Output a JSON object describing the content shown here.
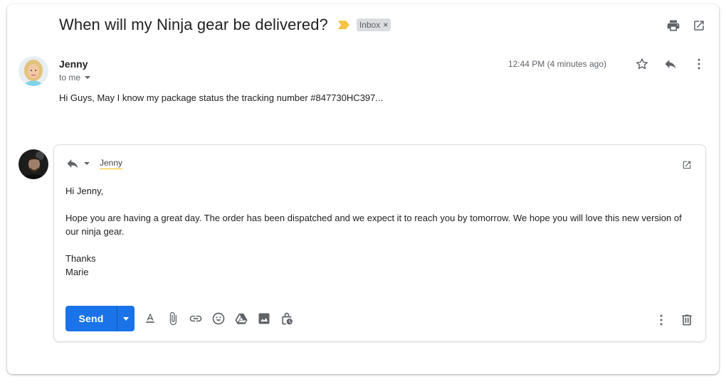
{
  "email": {
    "subject": "When will my Ninja gear be delivered?",
    "label": "Inbox",
    "label_remove": "×"
  },
  "message": {
    "sender": "Jenny",
    "to": "to me",
    "timestamp": "12:44 PM (4 minutes ago)",
    "snippet": "Hi Guys, May I know my package status the tracking number #847730HC397..."
  },
  "reply": {
    "recipient": "Jenny",
    "greeting": "Hi Jenny,",
    "paragraph": "Hope you are having a great day. The order has been dispatched and we expect it to reach you by tomorrow. We hope you will love this new version of our ninja gear.",
    "closing": "Thanks",
    "signature": "Marie",
    "send_label": "Send"
  },
  "colors": {
    "accent": "#1a73e8",
    "importance": "#f6c344",
    "label_bg": "#dadce0"
  },
  "icons": [
    "print-icon",
    "open-in-new-window-icon",
    "star-icon",
    "reply-icon",
    "more-vert-icon",
    "text-format-icon",
    "attach-icon",
    "link-icon",
    "emoji-icon",
    "drive-icon",
    "photo-icon",
    "confidential-icon",
    "delete-icon"
  ]
}
